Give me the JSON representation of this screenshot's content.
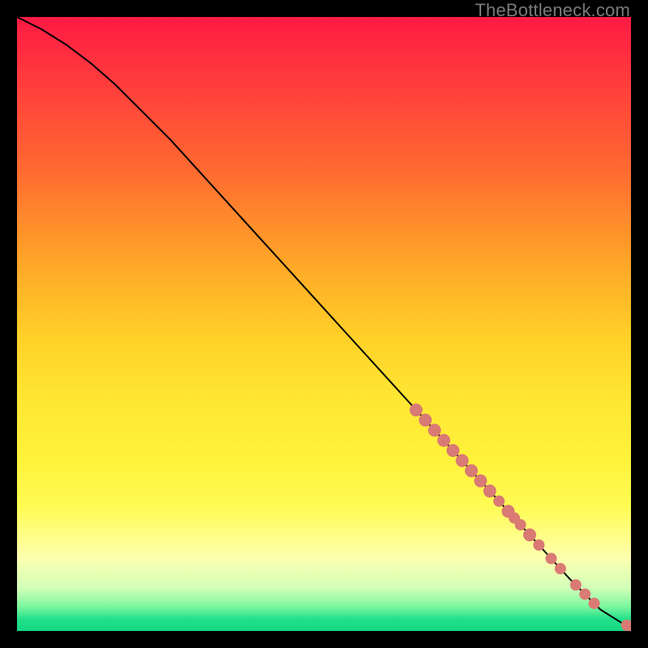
{
  "watermark": "TheBottleneck.com",
  "colors": {
    "curve": "#000000",
    "dot_fill": "#d97a74",
    "dot_stroke": "#d97a74"
  },
  "chart_data": {
    "type": "line",
    "title": "",
    "xlabel": "",
    "ylabel": "",
    "xlim": [
      0,
      100
    ],
    "ylim": [
      0,
      100
    ],
    "curve": {
      "x": [
        0,
        4,
        8,
        12,
        16,
        20,
        25,
        30,
        35,
        40,
        45,
        50,
        55,
        60,
        65,
        70,
        75,
        80,
        85,
        90,
        95,
        99,
        100
      ],
      "y": [
        100,
        98,
        95.5,
        92.5,
        89,
        85,
        80,
        74.5,
        69,
        63.5,
        58,
        52.5,
        47,
        41.5,
        36,
        30.5,
        25,
        19.5,
        14,
        8.5,
        3.5,
        1,
        0.8
      ]
    },
    "dots_on_curve": {
      "x": [
        65,
        66.5,
        68,
        69.5,
        71,
        72.5,
        74,
        75.5,
        77,
        78.5,
        80,
        81,
        82,
        83.5,
        85,
        87,
        88.5,
        91,
        92.5,
        94,
        99.3,
        100
      ],
      "r": [
        8,
        8,
        8,
        8,
        8,
        8,
        8,
        8,
        8,
        7,
        8,
        7,
        7,
        8,
        7,
        7,
        7,
        7,
        7,
        7,
        7,
        7
      ]
    }
  }
}
